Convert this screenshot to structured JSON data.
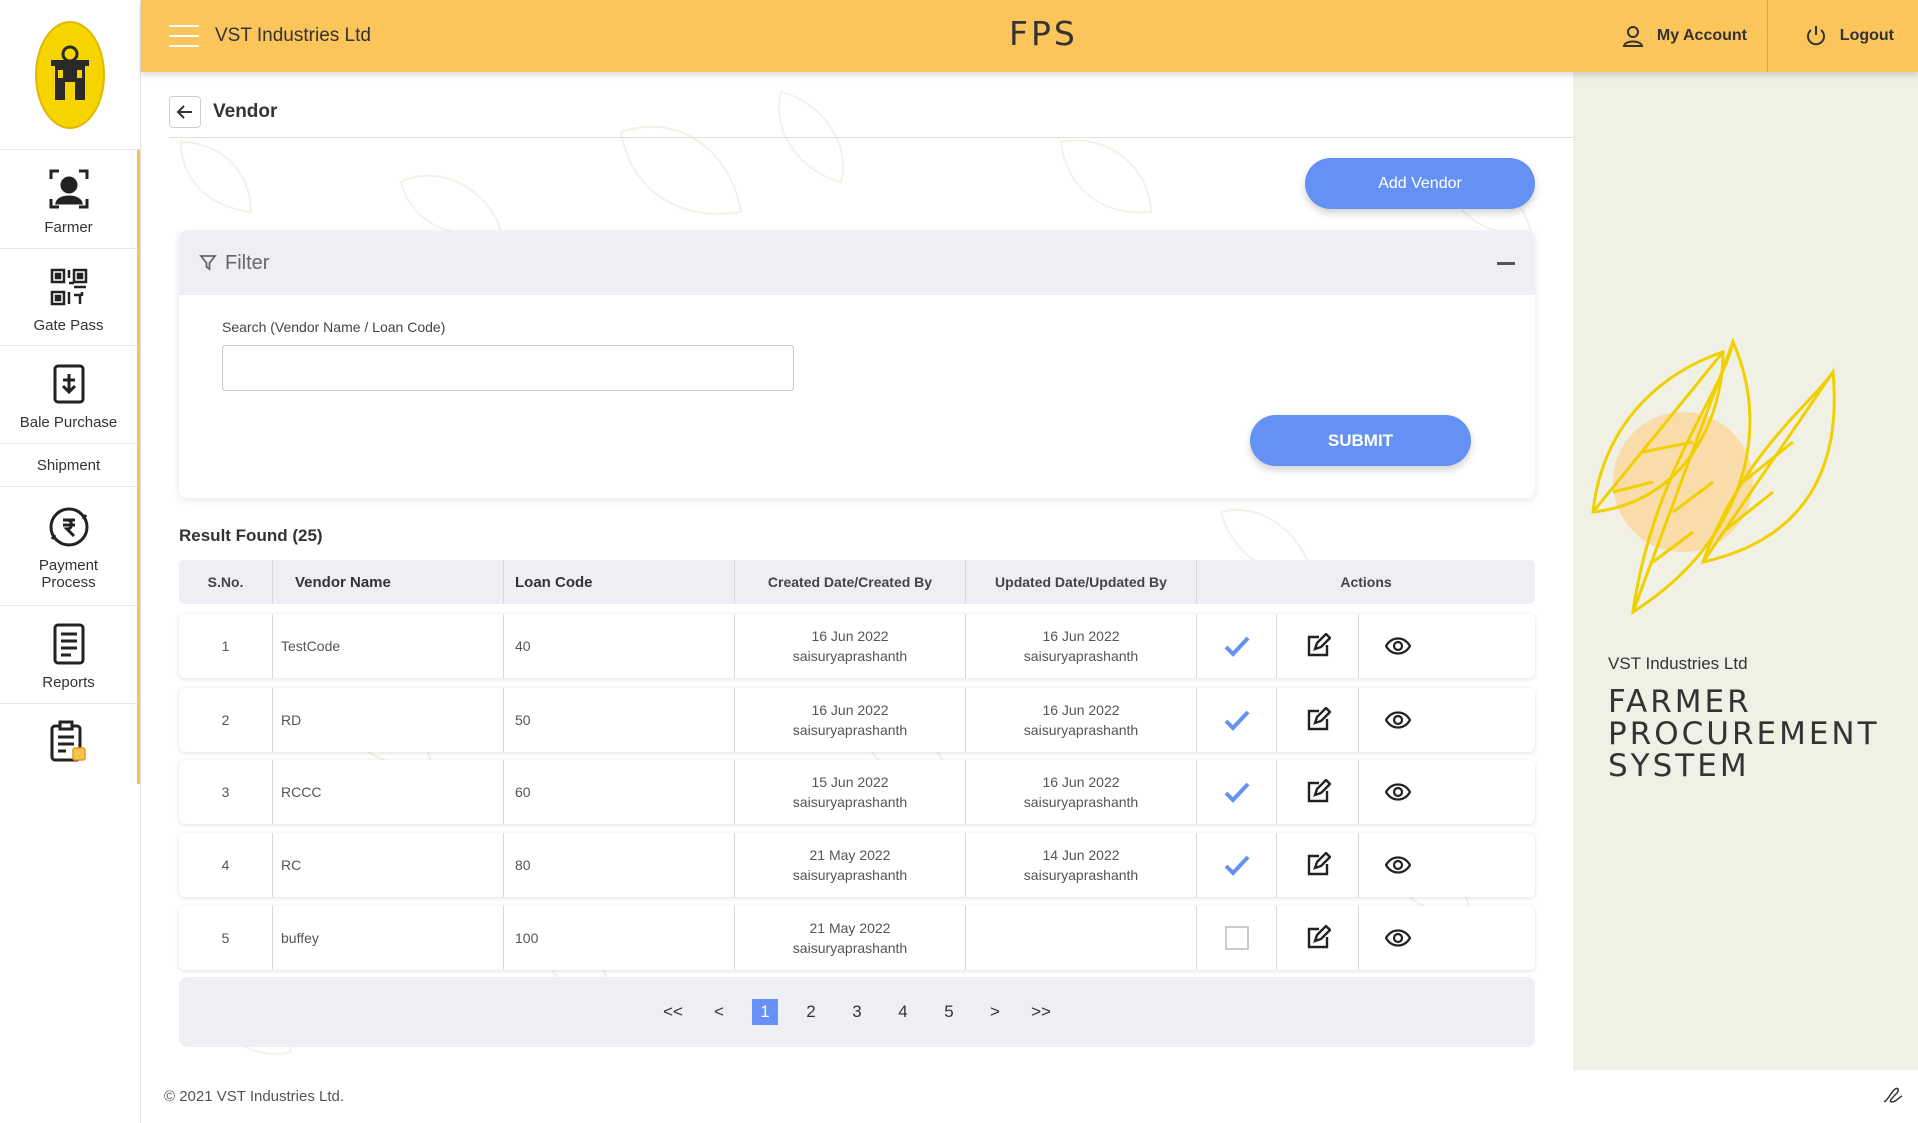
{
  "header": {
    "company": "VST Industries Ltd",
    "app_title": "FPS",
    "my_account": "My Account",
    "logout": "Logout"
  },
  "sidebar": {
    "items": [
      {
        "label": "Farmer",
        "icon": "farmer-icon"
      },
      {
        "label": "Gate Pass",
        "icon": "qr-code-icon"
      },
      {
        "label": "Bale Purchase",
        "icon": "bale-icon"
      },
      {
        "label": "Shipment",
        "icon": ""
      },
      {
        "label": "Payment Process",
        "icon": "payment-icon"
      },
      {
        "label": "Reports",
        "icon": "reports-icon"
      },
      {
        "label": "",
        "icon": "clipboard-icon"
      }
    ]
  },
  "page": {
    "title": "Vendor",
    "add_button": "Add Vendor"
  },
  "filter": {
    "title": "Filter",
    "search_label": "Search (Vendor Name / Loan Code)",
    "search_value": "",
    "submit": "SUBMIT"
  },
  "results": {
    "label": "Result Found (25)",
    "columns": [
      "S.No.",
      "Vendor Name",
      "Loan Code",
      "Created Date/Created By",
      "Updated Date/Updated By",
      "Actions"
    ],
    "rows": [
      {
        "sno": "1",
        "name": "TestCode",
        "loan": "40",
        "created_date": "16 Jun 2022",
        "created_by": "saisuryaprashanth",
        "updated_date": "16 Jun 2022",
        "updated_by": "saisuryaprashanth",
        "approved": true
      },
      {
        "sno": "2",
        "name": "RD",
        "loan": "50",
        "created_date": "16 Jun 2022",
        "created_by": "saisuryaprashanth",
        "updated_date": "16 Jun 2022",
        "updated_by": "saisuryaprashanth",
        "approved": true
      },
      {
        "sno": "3",
        "name": "RCCC",
        "loan": "60",
        "created_date": "15 Jun 2022",
        "created_by": "saisuryaprashanth",
        "updated_date": "16 Jun 2022",
        "updated_by": "saisuryaprashanth",
        "approved": true
      },
      {
        "sno": "4",
        "name": "RC",
        "loan": "80",
        "created_date": "21 May 2022",
        "created_by": "saisuryaprashanth",
        "updated_date": "14 Jun 2022",
        "updated_by": "saisuryaprashanth",
        "approved": true
      },
      {
        "sno": "5",
        "name": "buffey",
        "loan": "100",
        "created_date": "21 May 2022",
        "created_by": "saisuryaprashanth",
        "updated_date": "",
        "updated_by": "",
        "approved": false
      }
    ]
  },
  "pagination": {
    "first": "<<",
    "prev": "<",
    "pages": [
      "1",
      "2",
      "3",
      "4",
      "5"
    ],
    "active_page": "1",
    "next": ">",
    "last": ">>"
  },
  "right_panel": {
    "company": "VST Industries Ltd",
    "title": "FARMER PROCUREMENT SYSTEM"
  },
  "footer": {
    "copyright": "© 2021 VST Industries Ltd."
  },
  "colors": {
    "header": "#fcc55c",
    "accent": "#6591f5",
    "check": "#6591f5",
    "panel": "#f0f1e4"
  }
}
